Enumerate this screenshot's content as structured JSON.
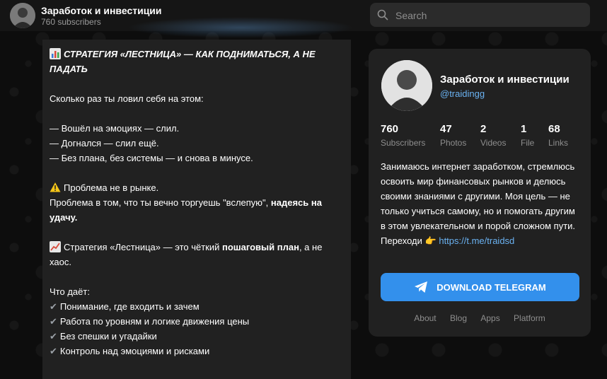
{
  "header": {
    "title": "Заработок и инвестиции",
    "subscribers": "760 subscribers",
    "search_placeholder": "Search"
  },
  "post": {
    "title": "СТРАТЕГИЯ «ЛЕСТНИЦА» — КАК ПОДНИМАТЬСЯ, А НЕ ПАДАТЬ",
    "question": "Сколько раз ты ловил себя на этом:",
    "lines": [
      "— Вошёл на эмоциях — слил.",
      "— Догнался — слил ещё.",
      "— Без плана, без системы — и снова в минусе."
    ],
    "problem_head": "Проблема не в рынке.",
    "problem_text_1": "Проблема в том, что ты вечно торгуешь \"вслепую\", ",
    "problem_text_bold": "надеясь на удачу.",
    "strategy_text_1": "Стратегия «Лестница» — это чёткий ",
    "strategy_text_bold": "пошаговый план",
    "strategy_text_2": ", а не хаос.",
    "gives_title": "Что даёт:",
    "benefits": [
      "Понимание, где входить и зачем",
      "Работа по уровням и логике движения цены",
      "Без спешки и угадайки",
      "Контроль над эмоциями и рисками"
    ]
  },
  "card": {
    "name": "Заработок и инвестиции",
    "handle": "@traidingg",
    "stats": [
      {
        "value": "760",
        "label": "Subscribers"
      },
      {
        "value": "47",
        "label": "Photos"
      },
      {
        "value": "2",
        "label": "Videos"
      },
      {
        "value": "1",
        "label": "File"
      },
      {
        "value": "68",
        "label": "Links"
      }
    ],
    "description": "Занимаюсь интернет заработком, стремлюсь освоить мир финансовых рынков и делюсь своими знаниями с другими. Моя цель — не только учиться самому, но и помогать другим в этом увлекательном и порой сложном пути. Переходи",
    "link": "https://t.me/traidsd",
    "download_label": "DOWNLOAD TELEGRAM",
    "footer": [
      "About",
      "Blog",
      "Apps",
      "Platform"
    ]
  },
  "colors": {
    "accent": "#3390ec",
    "link": "#6ab2f2",
    "panel": "#212121"
  }
}
